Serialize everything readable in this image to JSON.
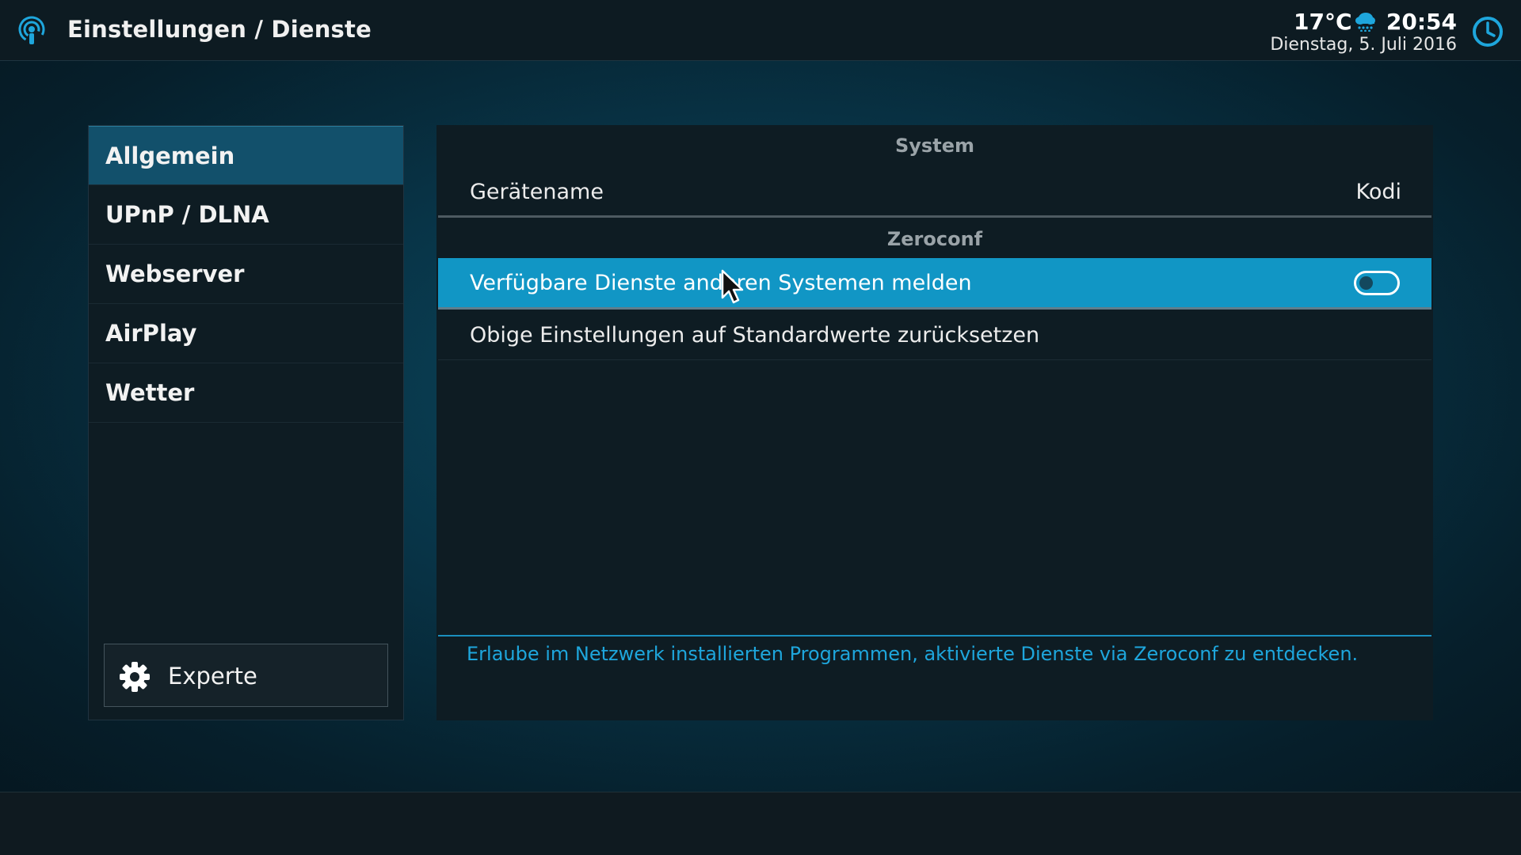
{
  "header": {
    "title": "Einstellungen / Dienste",
    "app_icon": "podcast-broadcast-icon",
    "weather": {
      "temperature": "17°C",
      "icon": "rain-cloud-icon"
    },
    "clock": {
      "time": "20:54",
      "date": "Dienstag, 5. Juli 2016",
      "icon": "clock-icon"
    }
  },
  "menu": {
    "items": [
      {
        "label": "Allgemein",
        "active": true
      },
      {
        "label": "UPnP / DLNA",
        "active": false
      },
      {
        "label": "Webserver",
        "active": false
      },
      {
        "label": "AirPlay",
        "active": false
      },
      {
        "label": "Wetter",
        "active": false
      }
    ],
    "level_button": {
      "label": "Experte",
      "icon": "gear-icon"
    }
  },
  "settings": {
    "sections": [
      {
        "title": "System",
        "rows": [
          {
            "label": "Gerätename",
            "value": "Kodi"
          }
        ]
      },
      {
        "title": "Zeroconf",
        "rows": [
          {
            "label": "Verfügbare Dienste anderen Systemen melden",
            "toggle": false,
            "focused": true
          },
          {
            "label": "Obige Einstellungen auf Standardwerte zurücksetzen"
          }
        ]
      }
    ],
    "description": "Erlaube im Netzwerk installierten Programmen, aktivierte Dienste via Zeroconf zu entdecken."
  },
  "colors": {
    "accent": "#1196c5",
    "description_text": "#1ea6dc",
    "active_menu": "#12506b",
    "panel": "#0e1c23"
  }
}
